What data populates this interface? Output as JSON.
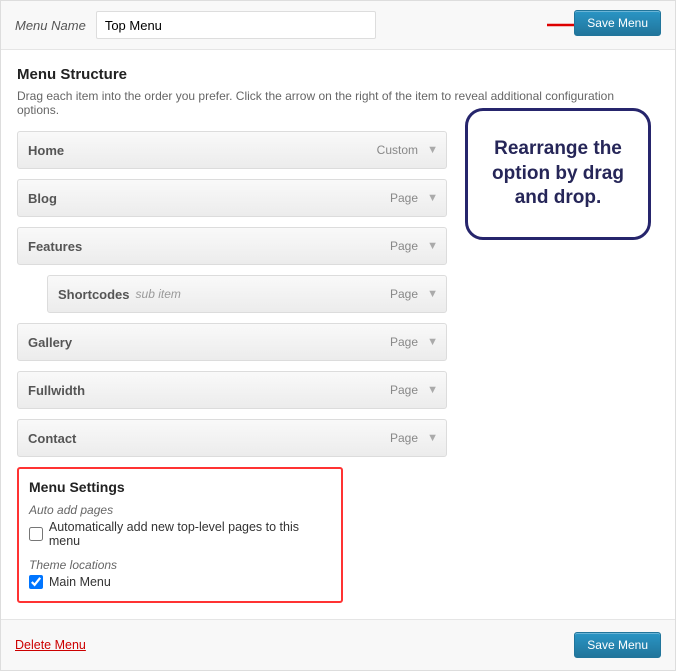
{
  "header": {
    "menu_name_label": "Menu Name",
    "menu_name_value": "Top Menu",
    "save_label": "Save Menu"
  },
  "callout": {
    "text": "Rearrange the option by drag and drop."
  },
  "structure": {
    "title": "Menu Structure",
    "hint": "Drag each item into the order you prefer. Click the arrow on the right of the item to reveal additional configuration options.",
    "items": [
      {
        "title": "Home",
        "type": "Custom",
        "sub": false,
        "subnote": ""
      },
      {
        "title": "Blog",
        "type": "Page",
        "sub": false,
        "subnote": ""
      },
      {
        "title": "Features",
        "type": "Page",
        "sub": false,
        "subnote": ""
      },
      {
        "title": "Shortcodes",
        "type": "Page",
        "sub": true,
        "subnote": "sub item"
      },
      {
        "title": "Gallery",
        "type": "Page",
        "sub": false,
        "subnote": ""
      },
      {
        "title": "Fullwidth",
        "type": "Page",
        "sub": false,
        "subnote": ""
      },
      {
        "title": "Contact",
        "type": "Page",
        "sub": false,
        "subnote": ""
      }
    ]
  },
  "settings": {
    "title": "Menu Settings",
    "auto_add_label": "Auto add pages",
    "auto_add_text": "Automatically add new top-level pages to this menu",
    "auto_add_checked": false,
    "theme_loc_label": "Theme locations",
    "theme_loc_text": "Main Menu",
    "theme_loc_checked": true
  },
  "footer": {
    "delete_label": "Delete Menu",
    "save_label": "Save Menu"
  }
}
